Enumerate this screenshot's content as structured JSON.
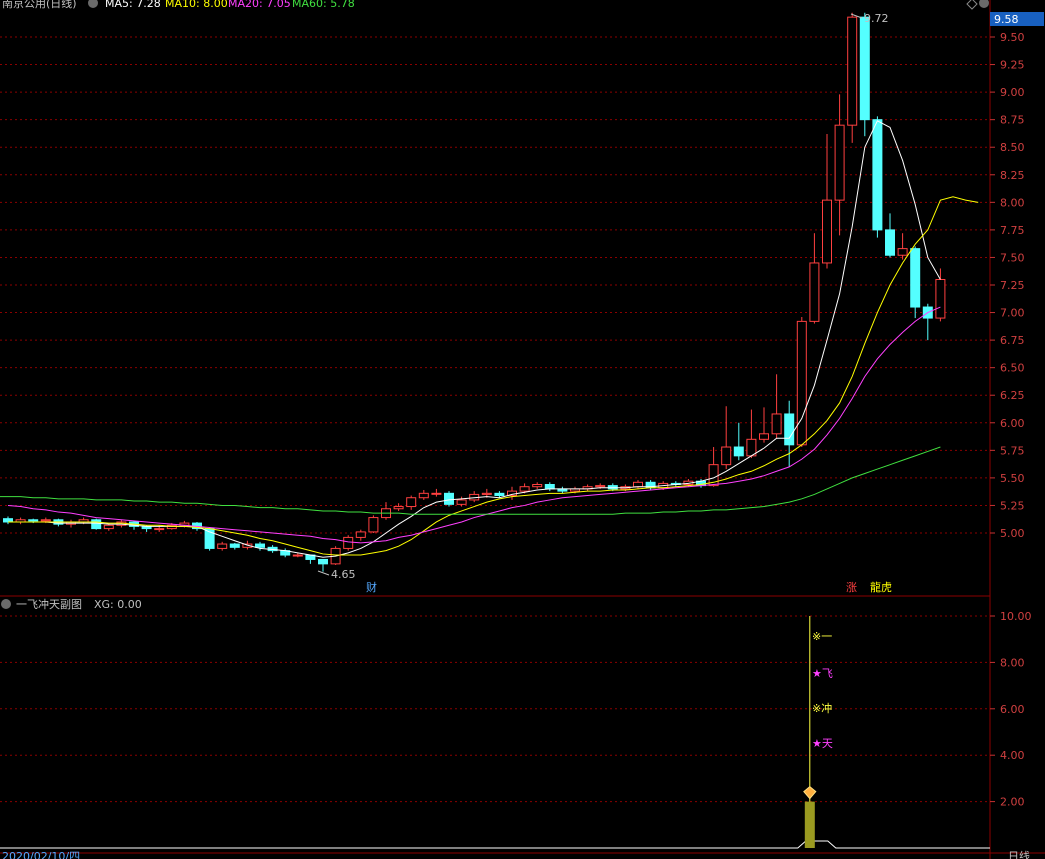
{
  "main_header": {
    "title": "南京公用(日线)",
    "ma5": "MA5: 7.28",
    "ma10": "MA10: 8.00",
    "ma20": "MA20: 7.05",
    "ma60": "MA60: 5.78"
  },
  "price_box": "9.58",
  "high_label": "9.72",
  "low_label": "4.65",
  "markers": {
    "cai": "财",
    "zhang": "涨",
    "longhu": "龍虎"
  },
  "sub_header": {
    "title": "一飞冲天副图",
    "xg": "XG: 0.00"
  },
  "signals": [
    "※一",
    "★飞",
    "※冲",
    "★天"
  ],
  "bottom_bar": {
    "date": "2020/02/10/四",
    "period": "日线"
  },
  "colors": {
    "up": "#ff4040",
    "down": "#54ffff",
    "ma5": "#ffffff",
    "ma10": "#ffff00",
    "ma20": "#ff40ff",
    "ma60": "#40e040",
    "grid": "#8b0000",
    "axis": "#c83232"
  },
  "chart_data": [
    {
      "type": "candlestick",
      "title": "南京公用(日线)",
      "y_ticks": [
        5.0,
        5.25,
        5.5,
        5.75,
        6.0,
        6.25,
        6.5,
        6.75,
        7.0,
        7.25,
        7.5,
        7.75,
        8.0,
        8.25,
        8.5,
        8.75,
        9.0,
        9.25,
        9.5
      ],
      "ylim": [
        4.45,
        9.78
      ],
      "candles": [
        [
          5.13,
          5.1,
          5.15,
          5.08
        ],
        [
          5.1,
          5.12,
          5.14,
          5.08
        ],
        [
          5.12,
          5.11,
          5.13,
          5.09
        ],
        [
          5.11,
          5.12,
          5.14,
          5.09
        ],
        [
          5.12,
          5.08,
          5.13,
          5.06
        ],
        [
          5.08,
          5.1,
          5.12,
          5.05
        ],
        [
          5.1,
          5.12,
          5.14,
          5.08
        ],
        [
          5.12,
          5.04,
          5.13,
          5.03
        ],
        [
          5.04,
          5.07,
          5.09,
          5.02
        ],
        [
          5.07,
          5.1,
          5.12,
          5.05
        ],
        [
          5.1,
          5.06,
          5.11,
          5.03
        ],
        [
          5.06,
          5.04,
          5.07,
          5.01
        ],
        [
          5.04,
          5.04,
          5.07,
          5.01
        ],
        [
          5.04,
          5.07,
          5.09,
          5.03
        ],
        [
          5.07,
          5.09,
          5.11,
          5.05
        ],
        [
          5.09,
          5.04,
          5.1,
          5.02
        ],
        [
          5.04,
          4.86,
          5.05,
          4.84
        ],
        [
          4.86,
          4.9,
          4.92,
          4.84
        ],
        [
          4.9,
          4.87,
          4.91,
          4.85
        ],
        [
          4.87,
          4.9,
          4.93,
          4.85
        ],
        [
          4.9,
          4.87,
          4.92,
          4.84
        ],
        [
          4.87,
          4.84,
          4.89,
          4.82
        ],
        [
          4.84,
          4.8,
          4.86,
          4.78
        ],
        [
          4.8,
          4.8,
          4.82,
          4.78
        ],
        [
          4.8,
          4.76,
          4.8,
          4.72
        ],
        [
          4.76,
          4.72,
          4.76,
          4.65
        ],
        [
          4.72,
          4.86,
          4.88,
          4.71
        ],
        [
          4.86,
          4.96,
          4.98,
          4.84
        ],
        [
          4.96,
          5.01,
          5.03,
          4.93
        ],
        [
          5.01,
          5.14,
          5.16,
          5.0
        ],
        [
          5.14,
          5.22,
          5.28,
          5.12
        ],
        [
          5.22,
          5.24,
          5.27,
          5.2
        ],
        [
          5.24,
          5.32,
          5.34,
          5.21
        ],
        [
          5.32,
          5.36,
          5.39,
          5.3
        ],
        [
          5.36,
          5.36,
          5.4,
          5.33
        ],
        [
          5.36,
          5.26,
          5.38,
          5.24
        ],
        [
          5.26,
          5.3,
          5.33,
          5.24
        ],
        [
          5.3,
          5.35,
          5.38,
          5.28
        ],
        [
          5.35,
          5.36,
          5.4,
          5.32
        ],
        [
          5.36,
          5.34,
          5.38,
          5.32
        ],
        [
          5.34,
          5.38,
          5.42,
          5.3
        ],
        [
          5.38,
          5.42,
          5.45,
          5.36
        ],
        [
          5.42,
          5.44,
          5.46,
          5.4
        ],
        [
          5.44,
          5.4,
          5.46,
          5.38
        ],
        [
          5.4,
          5.38,
          5.42,
          5.36
        ],
        [
          5.38,
          5.4,
          5.42,
          5.36
        ],
        [
          5.4,
          5.42,
          5.44,
          5.38
        ],
        [
          5.42,
          5.43,
          5.45,
          5.4
        ],
        [
          5.43,
          5.4,
          5.45,
          5.38
        ],
        [
          5.4,
          5.42,
          5.44,
          5.38
        ],
        [
          5.42,
          5.46,
          5.48,
          5.4
        ],
        [
          5.46,
          5.41,
          5.48,
          5.39
        ],
        [
          5.41,
          5.45,
          5.47,
          5.39
        ],
        [
          5.45,
          5.44,
          5.47,
          5.42
        ],
        [
          5.44,
          5.47,
          5.49,
          5.42
        ],
        [
          5.47,
          5.43,
          5.49,
          5.41
        ],
        [
          5.43,
          5.62,
          5.78,
          5.42
        ],
        [
          5.62,
          5.78,
          6.15,
          5.58
        ],
        [
          5.78,
          5.7,
          6.0,
          5.66
        ],
        [
          5.7,
          5.85,
          6.12,
          5.68
        ],
        [
          5.85,
          5.9,
          6.14,
          5.82
        ],
        [
          5.9,
          6.08,
          6.44,
          5.86
        ],
        [
          6.08,
          5.8,
          6.2,
          5.6
        ],
        [
          5.8,
          6.92,
          6.96,
          5.78
        ],
        [
          6.92,
          7.45,
          7.72,
          6.9
        ],
        [
          7.45,
          8.02,
          8.62,
          7.4
        ],
        [
          8.02,
          8.7,
          8.98,
          7.7
        ],
        [
          8.7,
          9.68,
          9.72,
          8.54
        ],
        [
          9.68,
          8.75,
          9.72,
          8.6
        ],
        [
          8.75,
          7.75,
          8.78,
          7.68
        ],
        [
          7.75,
          7.52,
          7.9,
          7.5
        ],
        [
          7.52,
          7.58,
          7.72,
          7.48
        ],
        [
          7.58,
          7.05,
          7.6,
          6.95
        ],
        [
          7.05,
          6.95,
          7.08,
          6.75
        ],
        [
          6.95,
          7.3,
          7.4,
          6.92
        ]
      ],
      "ma5": [
        5.1,
        5.1,
        5.1,
        5.1,
        5.09,
        5.09,
        5.09,
        5.09,
        5.08,
        5.08,
        5.07,
        5.06,
        5.06,
        5.06,
        5.06,
        5.06,
        5.01,
        4.97,
        4.93,
        4.89,
        4.86,
        4.85,
        4.84,
        4.82,
        4.8,
        4.78,
        4.79,
        4.82,
        4.86,
        4.92,
        5.0,
        5.08,
        5.15,
        5.23,
        5.28,
        5.3,
        5.31,
        5.32,
        5.33,
        5.32,
        5.35,
        5.37,
        5.39,
        5.4,
        5.4,
        5.4,
        5.4,
        5.41,
        5.41,
        5.41,
        5.42,
        5.42,
        5.43,
        5.44,
        5.45,
        5.47,
        5.5,
        5.56,
        5.63,
        5.7,
        5.77,
        5.86,
        5.86,
        6.04,
        6.34,
        6.75,
        7.17,
        7.78,
        8.5,
        8.74,
        8.68,
        8.38,
        7.98,
        7.5,
        7.3
      ],
      "ma10": [
        5.1,
        5.1,
        5.1,
        5.1,
        5.1,
        5.1,
        5.1,
        5.1,
        5.09,
        5.09,
        5.08,
        5.07,
        5.07,
        5.06,
        5.06,
        5.05,
        5.04,
        5.02,
        5.0,
        4.98,
        4.95,
        4.93,
        4.9,
        4.87,
        4.84,
        4.81,
        4.8,
        4.8,
        4.8,
        4.82,
        4.84,
        4.88,
        4.94,
        5.02,
        5.1,
        5.16,
        5.2,
        5.24,
        5.28,
        5.31,
        5.33,
        5.34,
        5.35,
        5.36,
        5.36,
        5.37,
        5.38,
        5.38,
        5.39,
        5.39,
        5.4,
        5.41,
        5.41,
        5.42,
        5.43,
        5.44,
        5.46,
        5.49,
        5.53,
        5.56,
        5.61,
        5.67,
        5.72,
        5.8,
        5.9,
        6.02,
        6.18,
        6.42,
        6.72,
        7.0,
        7.25,
        7.45,
        7.62,
        7.75,
        8.02,
        8.05,
        8.02,
        8.0
      ],
      "ma20": [
        5.25,
        5.24,
        5.22,
        5.21,
        5.19,
        5.18,
        5.16,
        5.14,
        5.13,
        5.12,
        5.11,
        5.1,
        5.09,
        5.08,
        5.07,
        5.06,
        5.05,
        5.04,
        5.03,
        5.02,
        5.01,
        5.0,
        4.99,
        4.98,
        4.97,
        4.95,
        4.94,
        4.92,
        4.91,
        4.92,
        4.93,
        4.96,
        4.98,
        5.01,
        5.04,
        5.07,
        5.1,
        5.14,
        5.17,
        5.2,
        5.23,
        5.25,
        5.28,
        5.3,
        5.32,
        5.33,
        5.34,
        5.35,
        5.36,
        5.37,
        5.38,
        5.39,
        5.4,
        5.41,
        5.42,
        5.43,
        5.44,
        5.45,
        5.47,
        5.49,
        5.52,
        5.56,
        5.6,
        5.67,
        5.76,
        5.89,
        6.04,
        6.22,
        6.42,
        6.58,
        6.71,
        6.82,
        6.92,
        7.0,
        7.05
      ],
      "ma60": [
        5.33,
        5.33,
        5.32,
        5.32,
        5.31,
        5.31,
        5.31,
        5.3,
        5.3,
        5.3,
        5.29,
        5.29,
        5.28,
        5.28,
        5.27,
        5.27,
        5.26,
        5.25,
        5.25,
        5.24,
        5.23,
        5.23,
        5.22,
        5.22,
        5.21,
        5.2,
        5.2,
        5.19,
        5.19,
        5.18,
        5.18,
        5.18,
        5.17,
        5.17,
        5.17,
        5.17,
        5.17,
        5.17,
        5.17,
        5.17,
        5.17,
        5.17,
        5.17,
        5.17,
        5.17,
        5.17,
        5.17,
        5.17,
        5.17,
        5.18,
        5.18,
        5.18,
        5.19,
        5.19,
        5.2,
        5.2,
        5.21,
        5.21,
        5.22,
        5.23,
        5.24,
        5.26,
        5.28,
        5.31,
        5.35,
        5.4,
        5.45,
        5.5,
        5.54,
        5.58,
        5.62,
        5.66,
        5.7,
        5.74,
        5.78
      ],
      "ma_note": "MA lines plotted across candles; colors white/yellow/magenta/green"
    },
    {
      "type": "bar",
      "title": "一飞冲天副图",
      "y_ticks": [
        2.0,
        4.0,
        6.0,
        8.0,
        10.0
      ],
      "ylim": [
        0,
        10.5
      ],
      "signal_bar_value": 2.0,
      "signal_line_value": 10.0,
      "baseline_value": 0.0
    }
  ]
}
